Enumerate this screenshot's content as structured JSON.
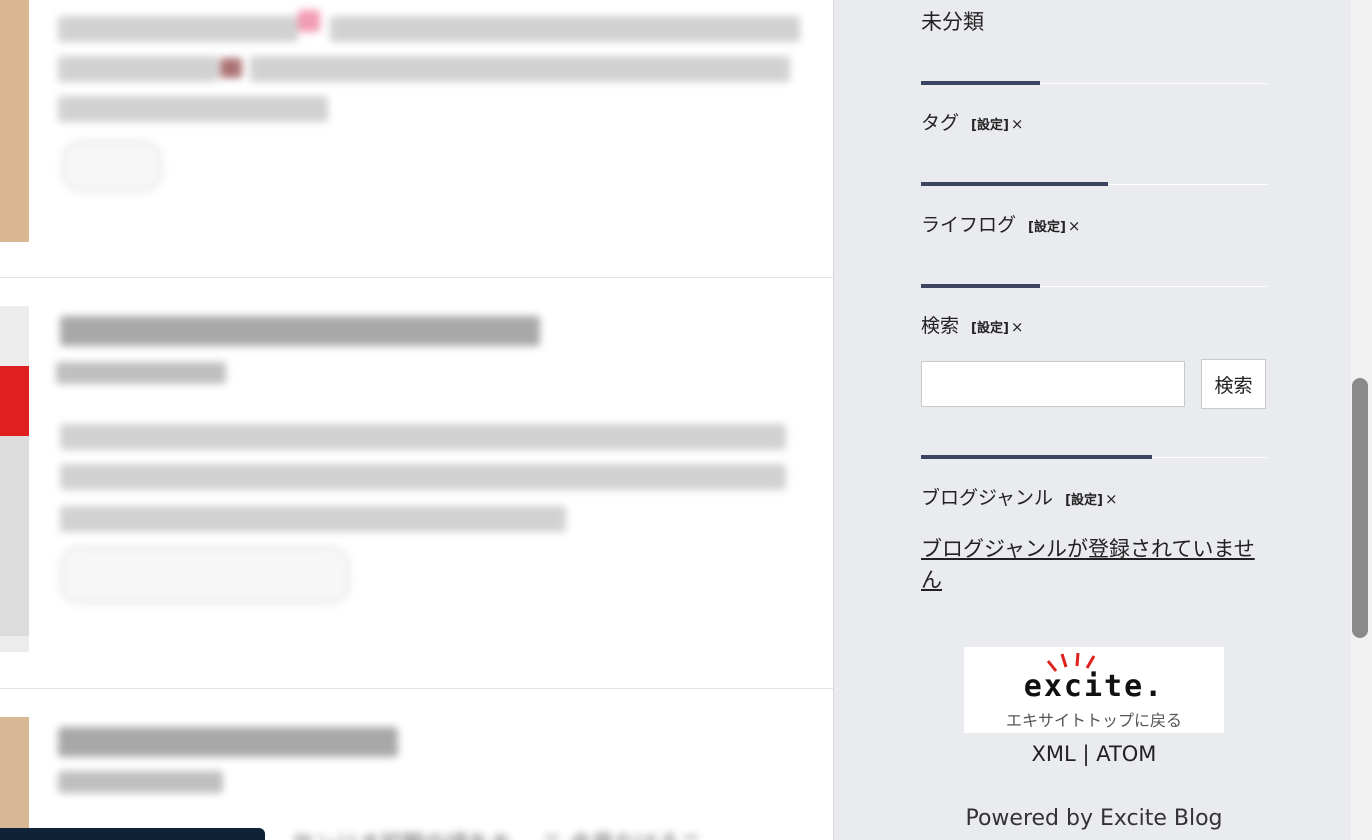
{
  "sidebar": {
    "category_item": "未分類",
    "setting_label": "[設定]",
    "close_glyph": "×",
    "widgets": [
      {
        "title": "タグ"
      },
      {
        "title": "ライフログ"
      },
      {
        "title": "検索"
      },
      {
        "title": "ブログジャンル"
      }
    ],
    "search": {
      "button_label": "検索",
      "value": ""
    },
    "genre_empty_message": "ブログジャンルが登録されていません",
    "banner": {
      "logo_text": "excite.",
      "caption": "エキサイトトップに戻る"
    },
    "feeds": {
      "xml": "XML",
      "separator": "|",
      "atom": "ATOM"
    },
    "powered_by": "Powered by Excite Blog"
  },
  "main": {
    "bottom_partial_text": "サンリオ初期の頃をキ… ニ 会員なはるニ"
  },
  "colors": {
    "sidebar_bg": "#e9ebef",
    "accent_line": "#3b4461",
    "bottom_bar": "#0f2338"
  }
}
